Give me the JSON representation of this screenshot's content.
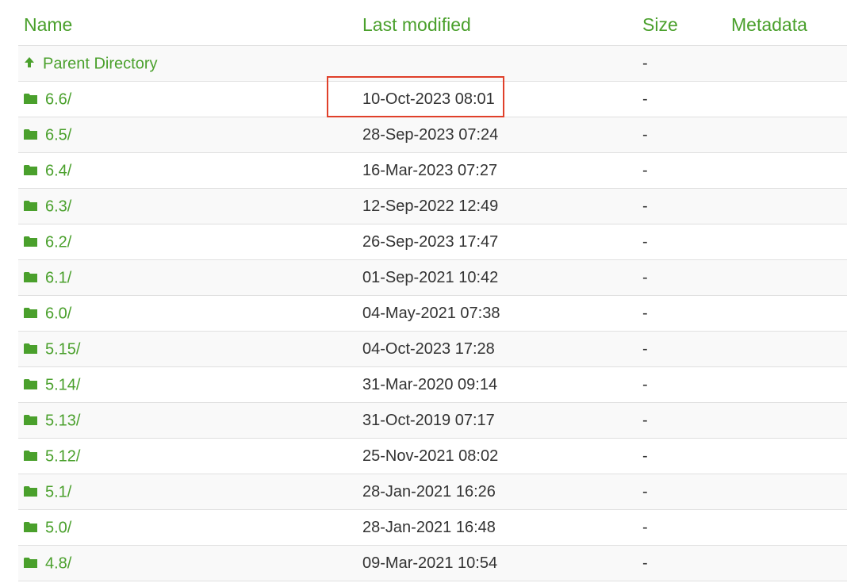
{
  "header": {
    "name": "Name",
    "last_modified": "Last modified",
    "size": "Size",
    "metadata": "Metadata"
  },
  "parent": {
    "label": "Parent Directory",
    "size": "-",
    "icon": "arrow-up-icon"
  },
  "entries": [
    {
      "name": "6.6/",
      "modified": "10-Oct-2023 08:01",
      "size": "-"
    },
    {
      "name": "6.5/",
      "modified": "28-Sep-2023 07:24",
      "size": "-"
    },
    {
      "name": "6.4/",
      "modified": "16-Mar-2023 07:27",
      "size": "-"
    },
    {
      "name": "6.3/",
      "modified": "12-Sep-2022 12:49",
      "size": "-"
    },
    {
      "name": "6.2/",
      "modified": "26-Sep-2023 17:47",
      "size": "-"
    },
    {
      "name": "6.1/",
      "modified": "01-Sep-2021 10:42",
      "size": "-"
    },
    {
      "name": "6.0/",
      "modified": "04-May-2021 07:38",
      "size": "-"
    },
    {
      "name": "5.15/",
      "modified": "04-Oct-2023 17:28",
      "size": "-"
    },
    {
      "name": "5.14/",
      "modified": "31-Mar-2020 09:14",
      "size": "-"
    },
    {
      "name": "5.13/",
      "modified": "31-Oct-2019 07:17",
      "size": "-"
    },
    {
      "name": "5.12/",
      "modified": "25-Nov-2021 08:02",
      "size": "-"
    },
    {
      "name": "5.1/",
      "modified": "28-Jan-2021 16:26",
      "size": "-"
    },
    {
      "name": "5.0/",
      "modified": "28-Jan-2021 16:48",
      "size": "-"
    },
    {
      "name": "4.8/",
      "modified": "09-Mar-2021 10:54",
      "size": "-"
    }
  ],
  "colors": {
    "link": "#4aa02c",
    "highlight": "#e0402a"
  },
  "icons": {
    "folder": "folder-icon"
  }
}
